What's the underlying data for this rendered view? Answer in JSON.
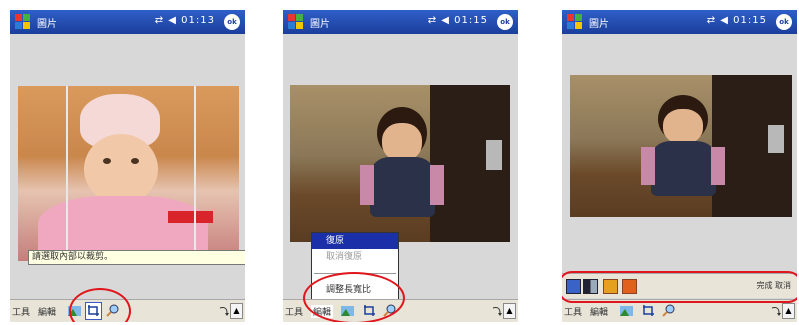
{
  "screens": [
    {
      "title": "圖片",
      "status": "⇄ ◀ 01:13",
      "ok": "ok",
      "tooltip": "請選取內部以裁剪。",
      "menu": {
        "tools": "工具",
        "edit": "編輯"
      }
    },
    {
      "title": "圖片",
      "status": "⇄ ◀ 01:15",
      "ok": "ok",
      "popup": [
        "復原",
        "取消復原",
        "調整長寬比"
      ],
      "menu": {
        "tools": "工具",
        "edit": "編輯"
      }
    },
    {
      "title": "圖片",
      "status": "⇄ ◀ 01:15",
      "ok": "ok",
      "toolbar_right": "完成 取消",
      "menu": {
        "tools": "工具",
        "edit": "編輯"
      }
    }
  ],
  "colors": {
    "accent": "#e0161d",
    "titlebar": "#1b3e9c",
    "menu_highlight": "#1a2fa8"
  }
}
